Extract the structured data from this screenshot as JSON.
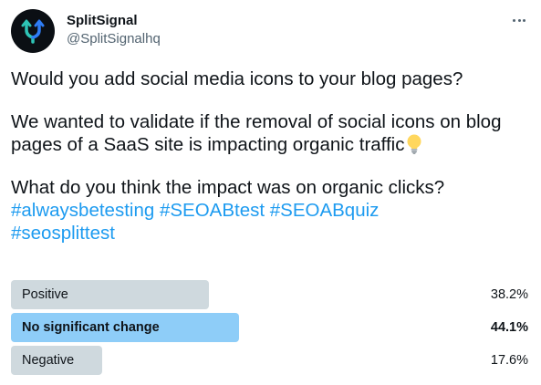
{
  "account": {
    "name": "SplitSignal",
    "handle": "@SplitSignalhq",
    "avatar_icon": "splitsignal-logo-icon"
  },
  "menu": {
    "icon": "more-horizontal-icon"
  },
  "tweet": {
    "line1": "Would you add social media icons to your blog pages?",
    "line2": "We wanted to validate if the removal of social icons on blog pages of a SaaS site is impacting organic traffic",
    "line2_emoji_icon": "light-bulb-icon",
    "line3": "What do you think the impact was on organic clicks?",
    "hashtags": [
      "#alwaysbetesting",
      "#SEOABtest",
      "#SEOABquiz",
      "#seosplittest"
    ]
  },
  "poll": {
    "options": [
      {
        "label": "Positive",
        "percent_text": "38.2%",
        "fraction": 0.382,
        "winner": false
      },
      {
        "label": "No significant change",
        "percent_text": "44.1%",
        "fraction": 0.441,
        "winner": true
      },
      {
        "label": "Negative",
        "percent_text": "17.6%",
        "fraction": 0.176,
        "winner": false
      }
    ]
  },
  "colors": {
    "hashtag": "#1d9bf0",
    "bar_default": "#cfd9de",
    "bar_winner": "#8ecdf8",
    "handle": "#536471"
  }
}
